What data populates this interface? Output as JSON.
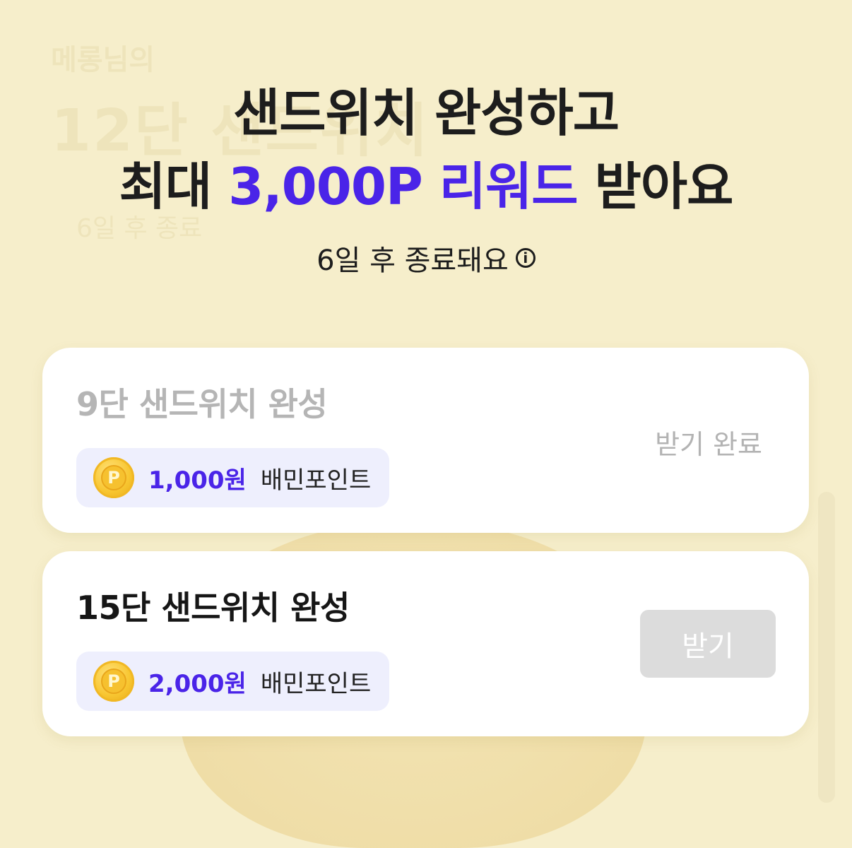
{
  "background": {
    "nickname": "메롱님의",
    "title": "12단 샌드위치",
    "days_left": "6일 후 종료"
  },
  "headline": {
    "line1": "샌드위치 완성하고",
    "line2_prefix": "최대 ",
    "line2_accent": "3,000P 리워드",
    "line2_suffix": " 받아요"
  },
  "ends": {
    "text": "6일 후 종료돼요",
    "icon": "info-icon"
  },
  "missions": [
    {
      "title": "9단 샌드위치 완성",
      "reward_amount": "1,000원",
      "reward_label": "배민포인트",
      "coin_symbol": "P",
      "status": "받기 완료"
    },
    {
      "title": "15단 샌드위치 완성",
      "reward_amount": "2,000원",
      "reward_label": "배민포인트",
      "coin_symbol": "P",
      "button": "받기"
    }
  ],
  "colors": {
    "accent": "#4a24e8",
    "background": "#f6eecb",
    "disabled_button": "#dcdcdc"
  }
}
